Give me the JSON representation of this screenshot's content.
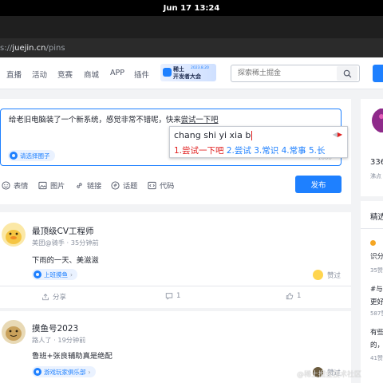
{
  "system": {
    "clock": "Jun 17  13:24"
  },
  "browser": {
    "url_prefix": "s://",
    "url_host": "juejin.cn",
    "url_path": "/pins"
  },
  "nav": {
    "items": [
      "直播",
      "活动",
      "竞赛",
      "商城",
      "APP",
      "插件"
    ],
    "banner_line1": "稀土",
    "banner_line2": "开发者大会",
    "banner_date": "2023.8.20",
    "search_placeholder": "探索稀土掘金"
  },
  "composer": {
    "text_before": "给老旧电脑装了一个新系统，感觉非常不错呢，快来",
    "text_preedit": "尝试一下吧",
    "circle_label": "请选择圈子",
    "counter": "1000",
    "toolbar": [
      "表情",
      "图片",
      "链接",
      "话题",
      "代码"
    ],
    "publish_label": "发布"
  },
  "ime": {
    "pinyin": "chang shi yi xia b",
    "candidates": [
      "1.尝试一下吧",
      "2.尝试",
      "3.常识",
      "4.常事",
      "5.长"
    ]
  },
  "posts": [
    {
      "name": "最顶级CV工程师",
      "meta": "美团@骑手 · 35分钟前",
      "body": "下雨的一天、美滋滋",
      "tag": "上班摸鱼",
      "good_thing": "赞过",
      "actions": [
        "分享",
        "1",
        "1"
      ],
      "avatar_color": "#f5c542"
    },
    {
      "name": "摸鱼号2023",
      "meta": "路人了 · 19分钟前",
      "body": "鲁班+张良辅助真是绝配",
      "tag": "游戏玩家俱乐部",
      "good_thing": "赞过",
      "avatar_color": "#c9a15b"
    }
  ],
  "sidebar": {
    "count": "336",
    "count_label": "沸点",
    "section_title": "精选",
    "items": [
      {
        "text": "识分",
        "meta": "35赞"
      },
      {
        "text": "#与",
        "sub": "更好",
        "meta": "587赞"
      },
      {
        "text": "有些",
        "sub": "的，",
        "meta": "41赞"
      }
    ]
  },
  "watermark": "@稀土掘金技术社区"
}
